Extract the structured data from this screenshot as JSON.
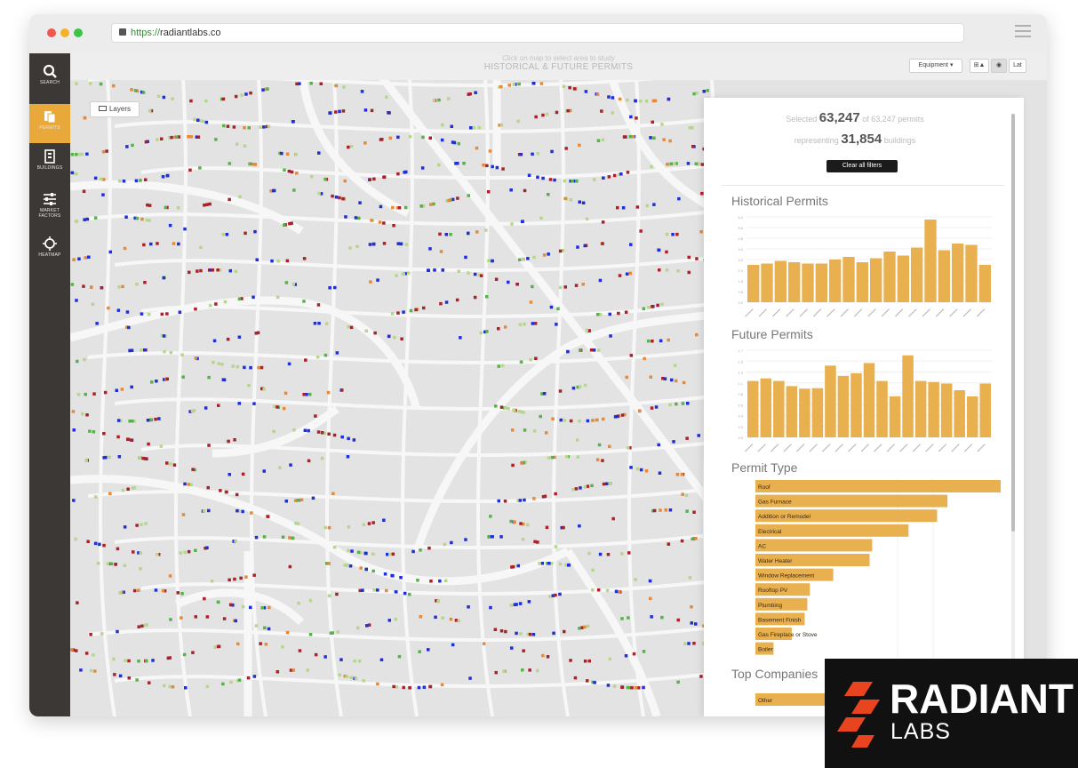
{
  "browser": {
    "url_protocol": "https://",
    "url_host": "radiantlabs.co"
  },
  "sidebar": {
    "items": [
      {
        "label": "SEARCH",
        "icon": "search-icon"
      },
      {
        "label": "PERMITS",
        "icon": "permits-icon"
      },
      {
        "label": "BUILDINGS",
        "icon": "building-icon"
      },
      {
        "label": "MARKET FACTORS",
        "icon": "sliders-icon"
      },
      {
        "label": "HEATMAP",
        "icon": "heatmap-icon"
      }
    ]
  },
  "header": {
    "subtitle": "Click on map to select area to study",
    "title": "HISTORICAL & FUTURE PERMITS",
    "equipment_label": "Equipment ▾",
    "view_button": "⊞▲",
    "globe_button": "◉",
    "lat_button": "Lat"
  },
  "map": {
    "layers_label": "Layers",
    "colors": {
      "background": "#e3e3e3",
      "street": "#f7f7f7",
      "blue": "#1f2ed6",
      "red": "#a8222a",
      "green": "#59b04d",
      "light_green": "#b7d58f",
      "orange": "#e48a3c"
    }
  },
  "panel": {
    "summary": {
      "prefix": "Selected",
      "selected": "63,247",
      "middle": "of 63,247 permits",
      "prefix2": "representing",
      "buildings": "31,854",
      "suffix2": "buildings"
    },
    "clear_label": "Clear all filters",
    "historical_title": "Historical Permits",
    "future_title": "Future Permits",
    "permit_type_title": "Permit Type",
    "companies_title": "Top Companies",
    "bar_color": "#e8b04f",
    "permit_types": [
      {
        "label": "Roof",
        "value": 100
      },
      {
        "label": "Gas Furnace",
        "value": 74
      },
      {
        "label": "Addition or Remodel",
        "value": 70
      },
      {
        "label": "Electrical",
        "value": 59
      },
      {
        "label": "AC",
        "value": 45
      },
      {
        "label": "Water Heater",
        "value": 44
      },
      {
        "label": "Window Replacement",
        "value": 30
      },
      {
        "label": "Rooftop PV",
        "value": 21
      },
      {
        "label": "Plumbing",
        "value": 20
      },
      {
        "label": "Basement Finish",
        "value": 19
      },
      {
        "label": "Gas Fireplace or Stove",
        "value": 14
      },
      {
        "label": "Boiler",
        "value": 7
      }
    ],
    "top_companies": [
      {
        "label": "Other",
        "value": 40
      }
    ]
  },
  "chart_data": [
    {
      "type": "bar",
      "title": "Historical Permits",
      "values": [
        2.8,
        2.9,
        3.1,
        3.0,
        2.9,
        2.9,
        3.2,
        3.4,
        3.0,
        3.3,
        3.8,
        3.5,
        4.1,
        6.2,
        3.9,
        4.4,
        4.3,
        2.8
      ],
      "ylim": [
        0,
        6.4
      ]
    },
    {
      "type": "bar",
      "title": "Future Permits",
      "values": [
        1.1,
        1.15,
        1.1,
        1.0,
        0.95,
        0.96,
        1.4,
        1.2,
        1.25,
        1.45,
        1.1,
        0.8,
        1.6,
        1.1,
        1.08,
        1.05,
        0.92,
        0.8,
        1.05
      ],
      "ylim": [
        0,
        1.7
      ]
    }
  ],
  "logo": {
    "name": "RADIANT",
    "sub": "LABS"
  }
}
